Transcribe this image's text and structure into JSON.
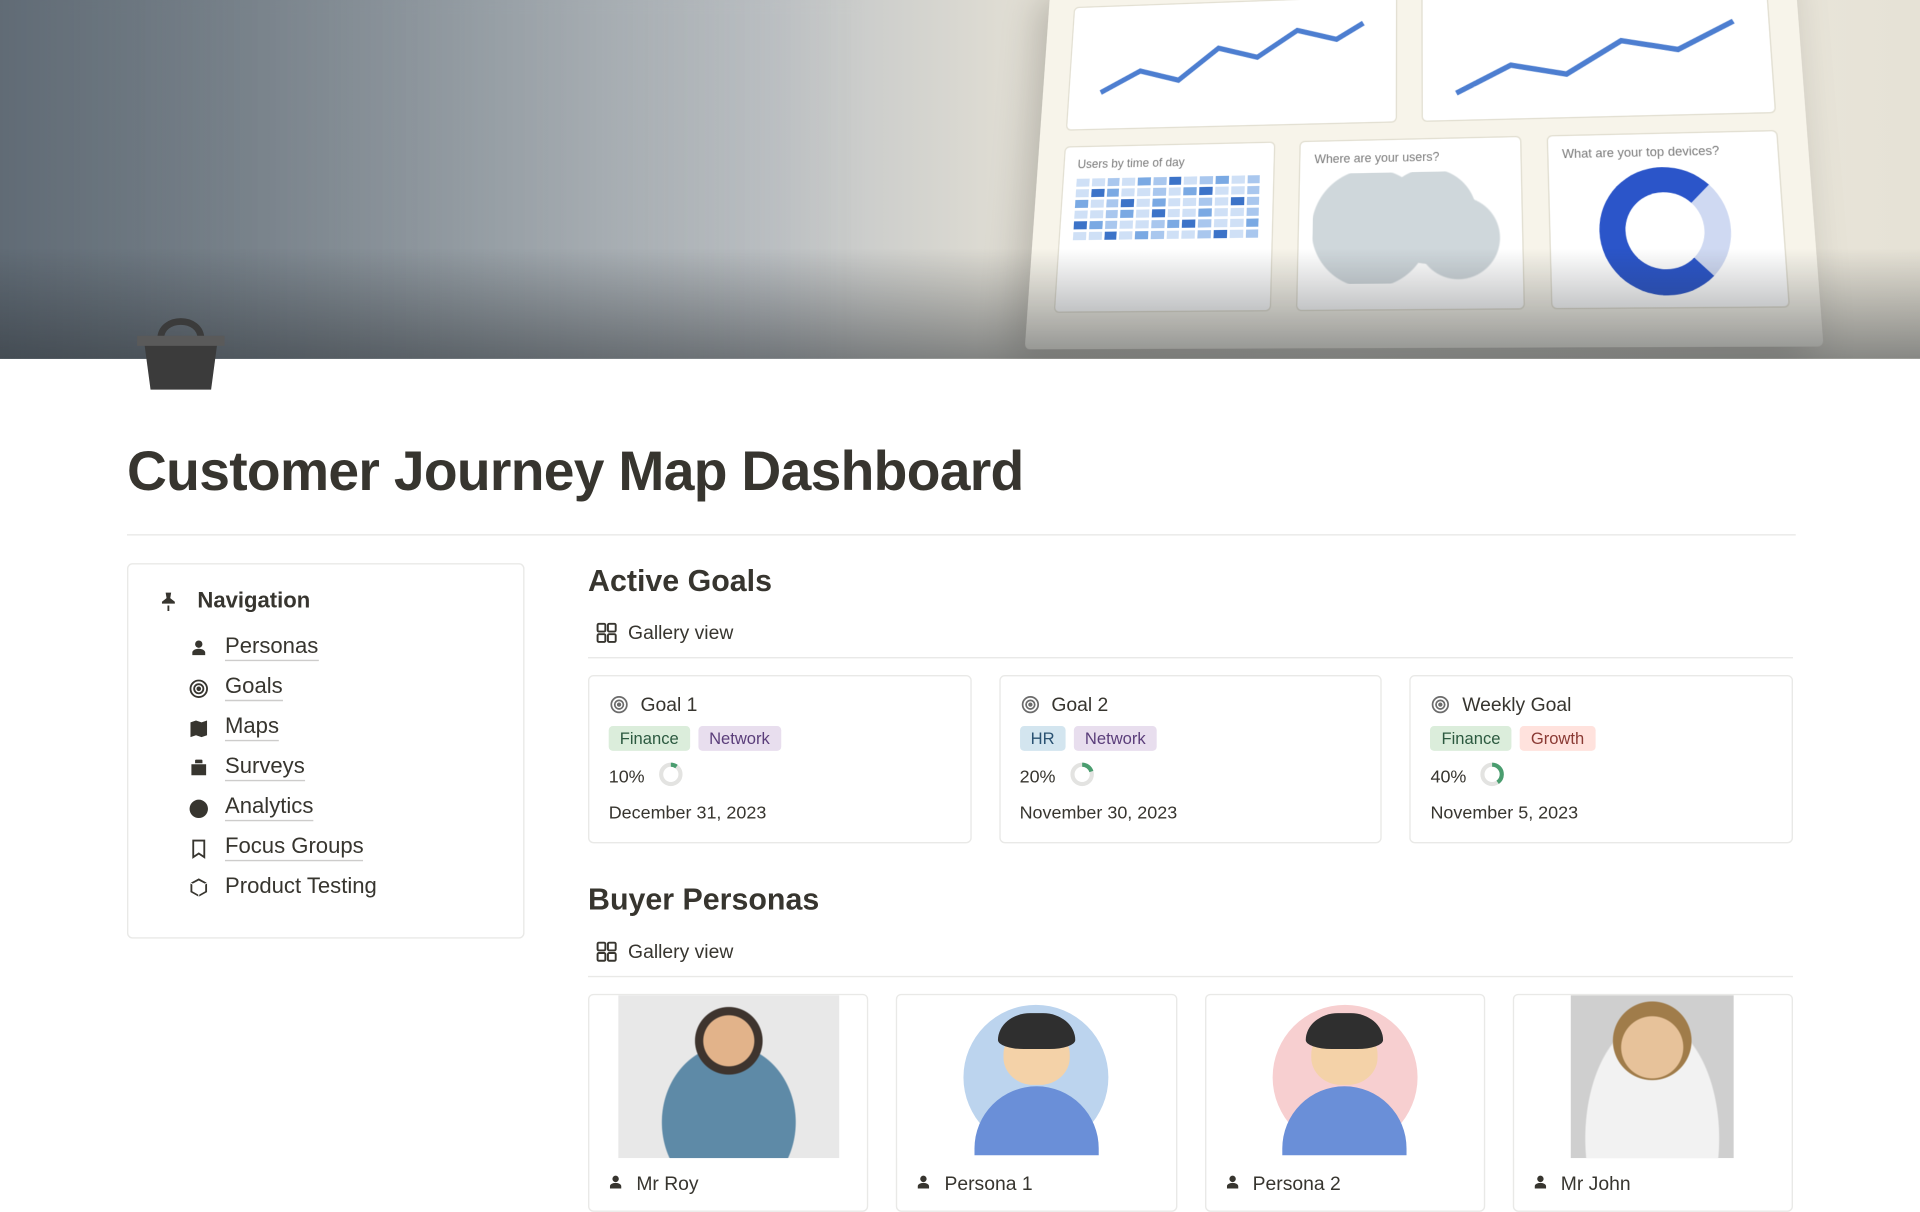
{
  "page": {
    "title": "Customer Journey Map Dashboard",
    "icon": "basket-icon"
  },
  "navigation": {
    "header": "Navigation",
    "items": [
      {
        "icon": "persona-icon",
        "label": "Personas"
      },
      {
        "icon": "target-icon",
        "label": "Goals"
      },
      {
        "icon": "map-icon",
        "label": "Maps"
      },
      {
        "icon": "briefcase-icon",
        "label": "Surveys"
      },
      {
        "icon": "chart-icon",
        "label": "Analytics"
      },
      {
        "icon": "bookmark-icon",
        "label": "Focus Groups"
      },
      {
        "icon": "cube-icon",
        "label": "Product Testing",
        "no_underline": true
      }
    ]
  },
  "active_goals": {
    "title": "Active Goals",
    "view_label": "Gallery view",
    "cards": [
      {
        "title": "Goal 1",
        "tags": [
          {
            "label": "Finance",
            "class": "tag-finance"
          },
          {
            "label": "Network",
            "class": "tag-network"
          }
        ],
        "progress_pct": "10%",
        "progress_value": 10,
        "date": "December 31, 2023"
      },
      {
        "title": "Goal 2",
        "tags": [
          {
            "label": "HR",
            "class": "tag-hr"
          },
          {
            "label": "Network",
            "class": "tag-network"
          }
        ],
        "progress_pct": "20%",
        "progress_value": 20,
        "date": "November 30, 2023"
      },
      {
        "title": "Weekly Goal",
        "tags": [
          {
            "label": "Finance",
            "class": "tag-finance"
          },
          {
            "label": "Growth",
            "class": "tag-growth"
          }
        ],
        "progress_pct": "40%",
        "progress_value": 40,
        "date": "November 5, 2023"
      }
    ]
  },
  "buyer_personas": {
    "title": "Buyer Personas",
    "view_label": "Gallery view",
    "cards": [
      {
        "name": "Mr Roy",
        "image": "photo1"
      },
      {
        "name": "Persona 1",
        "image": "illus-blue"
      },
      {
        "name": "Persona 2",
        "image": "illus-pink"
      },
      {
        "name": "Mr John",
        "image": "photo2"
      }
    ]
  },
  "colors": {
    "accent": "#37352f"
  }
}
